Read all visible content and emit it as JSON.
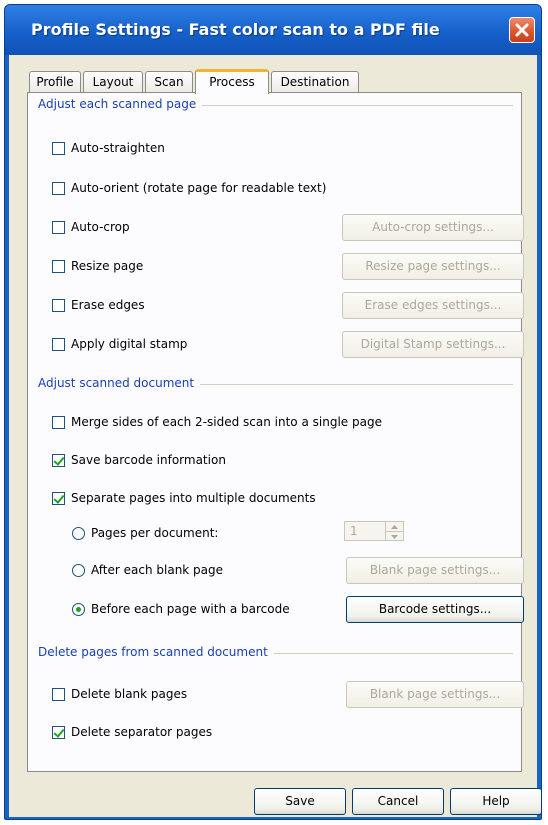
{
  "window": {
    "title": "Profile Settings - Fast color scan to a PDF file"
  },
  "tabs": [
    {
      "label": "Profile"
    },
    {
      "label": "Layout"
    },
    {
      "label": "Scan"
    },
    {
      "label": "Process"
    },
    {
      "label": "Destination"
    }
  ],
  "active_tab": "Process",
  "groups": {
    "page": {
      "label": "Adjust each scanned page"
    },
    "document": {
      "label": "Adjust scanned document"
    },
    "delete": {
      "label": "Delete pages from scanned document"
    }
  },
  "options": {
    "auto_straighten": {
      "label": "Auto-straighten",
      "checked": false
    },
    "auto_orient": {
      "label": "Auto-orient (rotate page for readable text)",
      "checked": false
    },
    "auto_crop": {
      "label": "Auto-crop",
      "checked": false,
      "button": "Auto-crop settings..."
    },
    "resize_page": {
      "label": "Resize page",
      "checked": false,
      "button": "Resize page settings..."
    },
    "erase_edges": {
      "label": "Erase edges",
      "checked": false,
      "button": "Erase edges settings..."
    },
    "digital_stamp": {
      "label": "Apply digital stamp",
      "checked": false,
      "button": "Digital Stamp settings..."
    },
    "merge_sides": {
      "label": "Merge sides of each 2-sided scan into a single page",
      "checked": false
    },
    "save_barcode": {
      "label": "Save barcode information",
      "checked": true
    },
    "separate_pages": {
      "label": "Separate pages into multiple documents",
      "checked": true
    },
    "pages_per_doc": {
      "label": "Pages per document:",
      "selected": false,
      "value": "1"
    },
    "after_blank": {
      "label": "After each blank page",
      "selected": false,
      "button": "Blank page settings..."
    },
    "before_barcode": {
      "label": "Before each page with a barcode",
      "selected": true,
      "button": "Barcode settings..."
    },
    "delete_blank": {
      "label": "Delete blank pages",
      "checked": false,
      "button": "Blank page settings..."
    },
    "delete_separator": {
      "label": "Delete separator pages",
      "checked": true
    }
  },
  "footer": {
    "save": "Save",
    "cancel": "Cancel",
    "help": "Help"
  }
}
